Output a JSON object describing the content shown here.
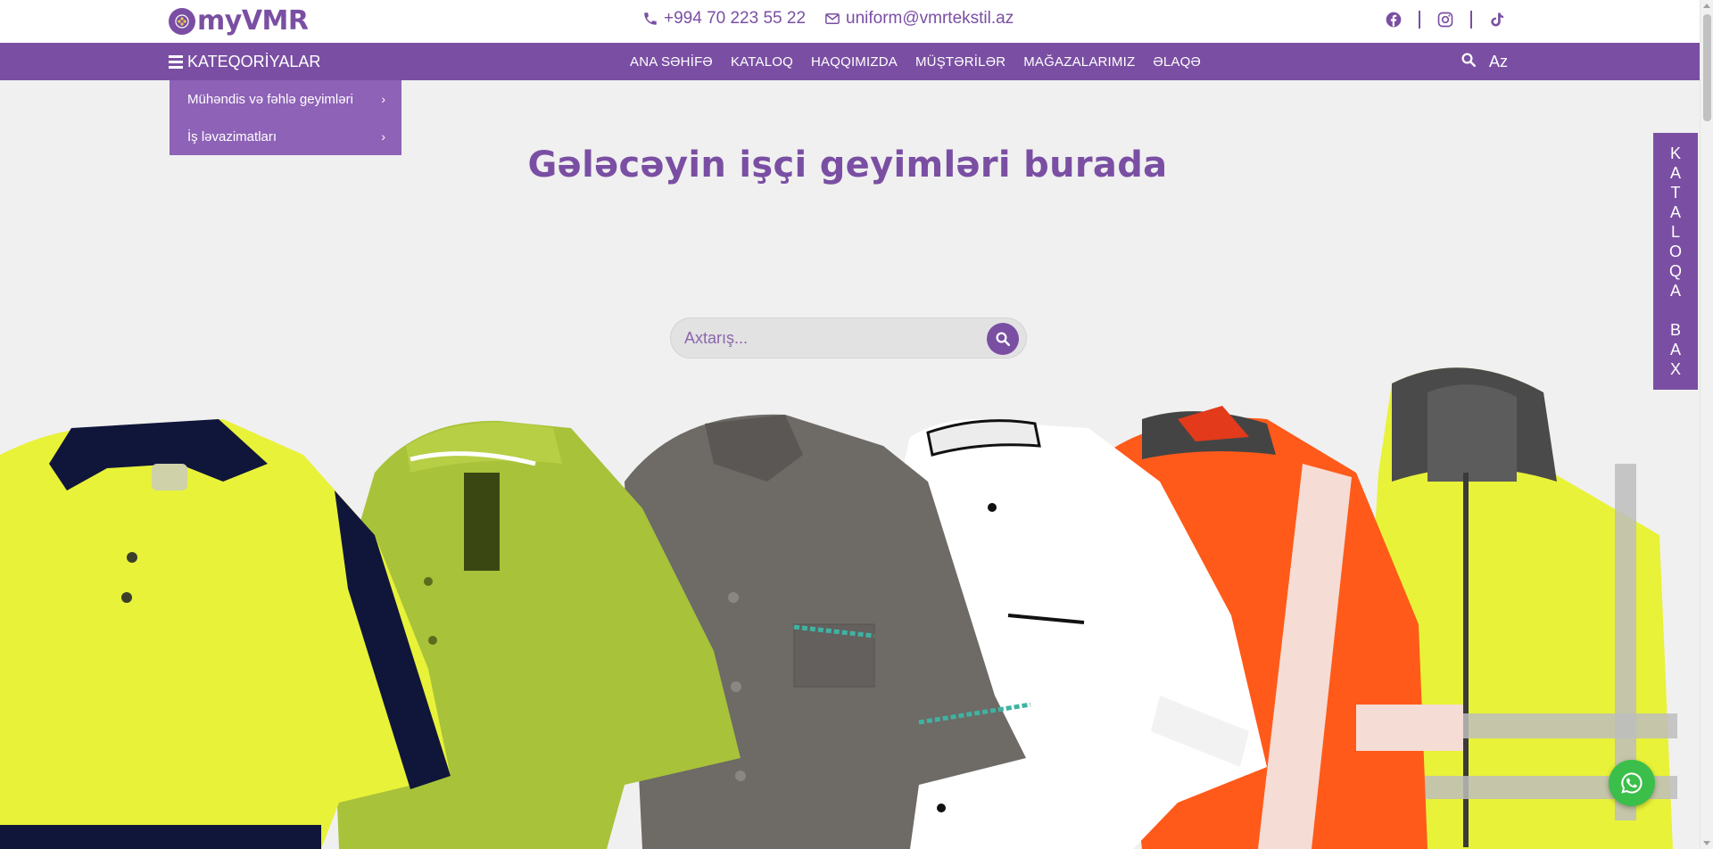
{
  "brand": {
    "name": "myVMR",
    "color": "#7a4fa3"
  },
  "contacts": {
    "phone": "+994 70 223 55 22",
    "email": "uniform@vmrtekstil.az",
    "phone_icon": "phone-icon",
    "email_icon": "envelope-icon"
  },
  "socials": [
    "facebook-icon",
    "instagram-icon",
    "tiktok-icon"
  ],
  "nav": {
    "categories_label": "KATEQORİYALAR",
    "items": [
      {
        "label": "ANA SƏHİFƏ"
      },
      {
        "label": "KATALOQ"
      },
      {
        "label": "HAQQIMIZDA"
      },
      {
        "label": "MÜŞTƏRİLƏR"
      },
      {
        "label": "MAĞAZALARIMIZ"
      },
      {
        "label": "ƏLAQƏ"
      }
    ],
    "language": "Az"
  },
  "dropdown": {
    "items": [
      {
        "label": "Mühəndis və fəhlə geyimləri"
      },
      {
        "label": "İş ləvazimatları"
      }
    ]
  },
  "hero": {
    "title": "Gələcəyin işçi geyimləri burada",
    "search_placeholder": "Axtarış..."
  },
  "side_tab": {
    "label": [
      "K",
      "A",
      "T",
      "A",
      "L",
      "O",
      "Q",
      "A",
      "",
      "B",
      "A",
      "X"
    ]
  },
  "products": [
    "hi-vis yellow polo shirt",
    "lime green polo shirt",
    "grey work tunic",
    "white chef jacket",
    "orange hi-vis sweatshirt",
    "yellow hi-vis hoodie"
  ],
  "colors": {
    "accent": "#7a4fa3",
    "dropdown_bg": "#8e62b7",
    "background": "#f0f0f0",
    "whatsapp": "#3bbf4a"
  }
}
